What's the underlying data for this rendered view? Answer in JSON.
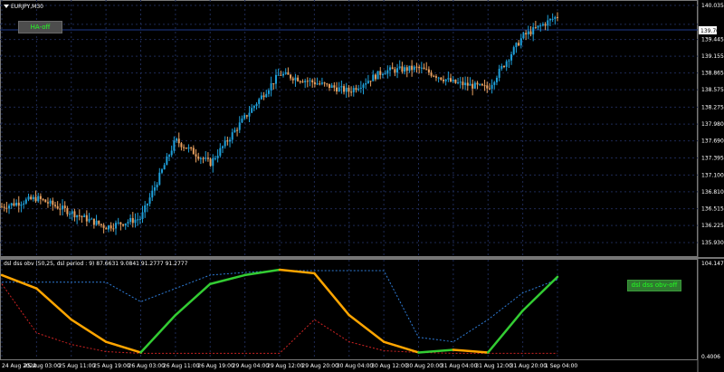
{
  "window": {
    "title": "EURJPY,M30"
  },
  "buttons": {
    "ha_label": "HA-off",
    "dss_label": "dsl dss obv-off"
  },
  "indicator": {
    "title": "dsl dss obv (50,25, dsl period : 9) 87.6631 9.0841 91.2777 91.2777"
  },
  "price_axis": {
    "ticks": [
      "140.035",
      "139.707",
      "139.445",
      "139.155",
      "138.865",
      "138.575",
      "138.275",
      "137.980",
      "137.690",
      "137.395",
      "137.100",
      "136.810",
      "136.515",
      "136.225",
      "135.930"
    ],
    "current_price": "139.707"
  },
  "indicator_axis": {
    "top": "104.147",
    "bottom": "0.4006"
  },
  "time_axis": [
    "24 Aug 2022",
    "25 Aug 03:00",
    "25 Aug 11:00",
    "25 Aug 19:00",
    "26 Aug 03:00",
    "26 Aug 11:00",
    "26 Aug 19:00",
    "29 Aug 04:00",
    "29 Aug 12:00",
    "29 Aug 20:00",
    "30 Aug 04:00",
    "30 Aug 12:00",
    "30 Aug 20:00",
    "31 Aug 04:00",
    "31 Aug 12:00",
    "31 Aug 20:00",
    "1 Sep 04:00"
  ],
  "colors": {
    "background": "#000000",
    "bull": "#1e9fd9",
    "bear": "#e8a060",
    "grid": "#1e2a55",
    "osc_up": "#33cc33",
    "osc_down": "#ffa500",
    "osc_neutral": "#bbbbbb",
    "level_upper": "#2e7bd6",
    "level_lower": "#cc2222",
    "current_line": "#1e3a8a"
  },
  "chart_data": [
    {
      "type": "candlestick",
      "title": "EURJPY,M30",
      "ylim": [
        135.93,
        140.035
      ],
      "x": [
        "24 Aug 2022",
        "25 Aug 03:00",
        "25 Aug 11:00",
        "25 Aug 19:00",
        "26 Aug 03:00",
        "26 Aug 11:00",
        "26 Aug 19:00",
        "29 Aug 04:00",
        "29 Aug 12:00",
        "29 Aug 20:00",
        "30 Aug 04:00",
        "30 Aug 12:00",
        "30 Aug 20:00",
        "31 Aug 04:00",
        "31 Aug 12:00",
        "31 Aug 20:00",
        "1 Sep 04:00"
      ],
      "series": [
        {
          "values": [
            136.55,
            136.7,
            136.45,
            136.2,
            136.35,
            137.7,
            137.3,
            138.1,
            138.85,
            138.7,
            138.55,
            138.9,
            138.95,
            138.7,
            138.6,
            139.5,
            139.85
          ]
        }
      ]
    },
    {
      "type": "line",
      "title": "dsl dss obv (50,25, dsl period : 9) 87.6631 9.0841 91.2777 91.2777",
      "ylim": [
        0.4006,
        104.147
      ],
      "x": [
        "24 Aug 2022",
        "25 Aug 03:00",
        "25 Aug 11:00",
        "25 Aug 19:00",
        "26 Aug 03:00",
        "26 Aug 11:00",
        "26 Aug 19:00",
        "29 Aug 04:00",
        "29 Aug 12:00",
        "29 Aug 20:00",
        "30 Aug 04:00",
        "30 Aug 12:00",
        "30 Aug 20:00",
        "31 Aug 04:00",
        "31 Aug 12:00",
        "31 Aug 20:00",
        "1 Sep 04:00"
      ],
      "series": [
        {
          "values": [
            90,
            75,
            40,
            15,
            3,
            45,
            80,
            90,
            96,
            92,
            45,
            15,
            3,
            6,
            3,
            50,
            88
          ]
        },
        {
          "values": [
            82,
            82,
            82,
            82,
            60,
            75,
            90,
            93,
            95,
            95,
            95,
            95,
            20,
            15,
            40,
            70,
            85
          ]
        },
        {
          "values": [
            80,
            25,
            12,
            4,
            2,
            2,
            2,
            2,
            2,
            40,
            15,
            5,
            3,
            2,
            2,
            2,
            2
          ]
        }
      ]
    }
  ]
}
